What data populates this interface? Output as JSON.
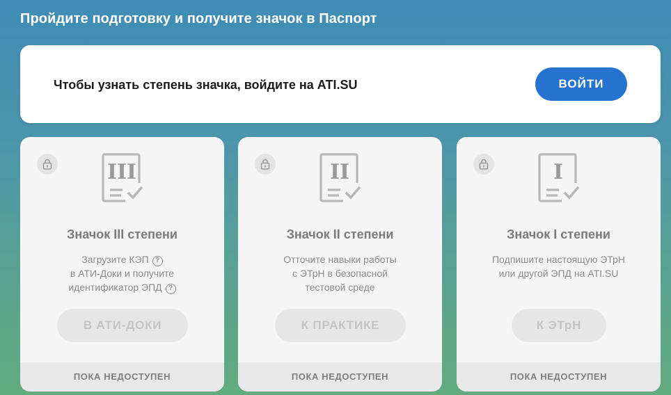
{
  "header": {
    "title": "Пройдите подготовку и получите значок в Паспорт"
  },
  "login": {
    "text": "Чтобы узнать степень значка, войдите на ATI.SU",
    "button_label": "ВОЙТИ"
  },
  "colors": {
    "primary": "#2573cf",
    "card_bg": "#f5f5f5",
    "status_bg": "#e8e8e8"
  },
  "badges": [
    {
      "roman": "III",
      "title": "Значок III степени",
      "desc_lines": [
        "Загрузите КЭП",
        "в АТИ-Доки и получите",
        "идентификатор ЭПД"
      ],
      "help_icon": "?",
      "button_label": "В АТИ-ДОКИ",
      "status": "ПОКА НЕДОСТУПЕН"
    },
    {
      "roman": "II",
      "title": "Значок II степени",
      "desc_lines": [
        "Отточите навыки работы",
        "с ЭТрН в безопасной",
        "тестовой среде"
      ],
      "button_label": "К ПРАКТИКЕ",
      "status": "ПОКА НЕДОСТУПЕН"
    },
    {
      "roman": "I",
      "title": "Значок I степени",
      "desc_lines": [
        "Подпишите настоящую ЭТрН",
        "или другой ЭПД на ATI.SU"
      ],
      "button_label": "К ЭТрН",
      "status": "ПОКА НЕДОСТУПЕН"
    }
  ]
}
